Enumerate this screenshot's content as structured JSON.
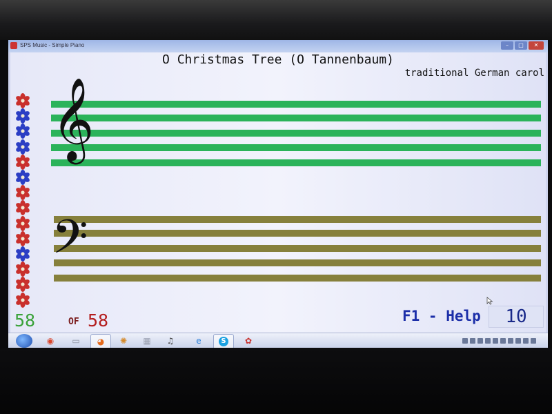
{
  "window": {
    "title": "SPS Music - Simple Piano",
    "min_glyph": "–",
    "max_glyph": "□",
    "close_glyph": "✕"
  },
  "song": {
    "title": "O Christmas Tree (O Tannenbaum)",
    "subtitle": "traditional German carol"
  },
  "progress": {
    "current": "58",
    "of_label": "OF",
    "total": "58"
  },
  "help": {
    "label": "F1 - Help"
  },
  "score": {
    "value": "10"
  },
  "flowers": [
    {
      "color": "red"
    },
    {
      "color": "blue"
    },
    {
      "color": "blue"
    },
    {
      "color": "blue"
    },
    {
      "color": "red"
    },
    {
      "color": "blue"
    },
    {
      "color": "red"
    },
    {
      "color": "red"
    },
    {
      "color": "red"
    },
    {
      "color": "red"
    },
    {
      "color": "blue"
    },
    {
      "color": "red"
    },
    {
      "color": "red"
    },
    {
      "color": "red"
    }
  ],
  "colors": {
    "treble_staff": "#2bb35a",
    "bass_staff": "#86803c",
    "flower_red": "#c9302c",
    "flower_blue": "#2b3ec4",
    "count_current": "#3aa23a",
    "count_total": "#b41e1e",
    "help_text": "#1b2ea8"
  },
  "taskbar": {
    "items": [
      {
        "icon": "chrome-icon",
        "glyph": "◉",
        "color": "#d9452b"
      },
      {
        "icon": "folder-icon",
        "glyph": "▭",
        "color": "#8a8f9e"
      },
      {
        "icon": "firefox-icon",
        "glyph": "◕",
        "color": "#e46a1c"
      },
      {
        "icon": "palette-icon",
        "glyph": "✺",
        "color": "#d58a2a"
      },
      {
        "icon": "film-icon",
        "glyph": "▦",
        "color": "#9aa0b0"
      },
      {
        "icon": "music-notes-icon",
        "glyph": "♫",
        "color": "#444"
      },
      {
        "icon": "internet-explorer-icon",
        "glyph": "e",
        "color": "#2b7fd8"
      },
      {
        "icon": "skype-icon",
        "glyph": "S",
        "color": "#fff"
      },
      {
        "icon": "piano-app-icon",
        "glyph": "✿",
        "color": "#c8302c"
      }
    ]
  }
}
